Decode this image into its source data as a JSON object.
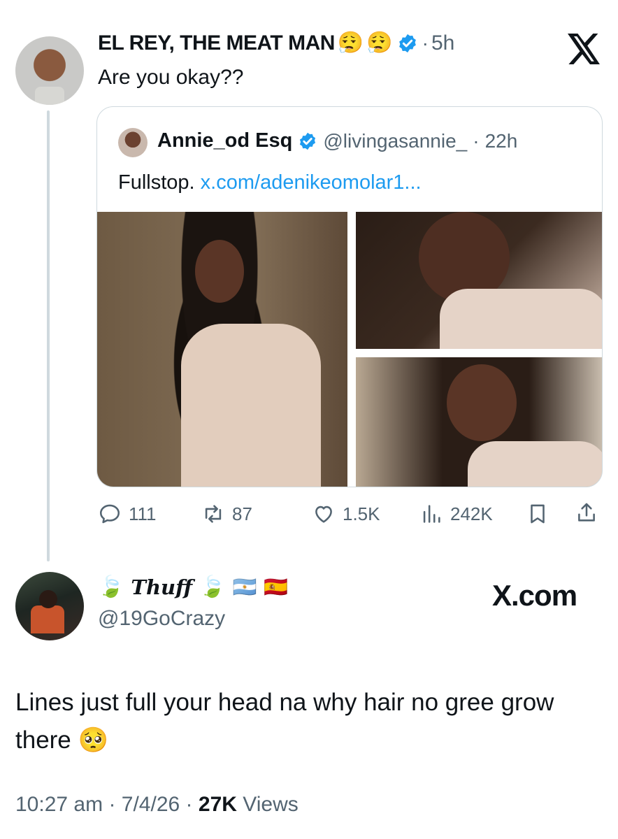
{
  "reply_tweet": {
    "author_name": "EL REY, THE MEAT MAN",
    "author_emojis": [
      "😮‍💨",
      "😮‍💨"
    ],
    "time": "5h",
    "sep": "·",
    "text": "Are you okay??",
    "x_logo": "𝕏"
  },
  "quoted_tweet": {
    "author_name": "Annie_od Esq",
    "handle": "@livingasannie_",
    "time": "22h",
    "sep": "·",
    "text": "Fullstop.",
    "link": "x.com/adenikeomolar1..."
  },
  "actions": {
    "replies": "111",
    "retweets": "87",
    "likes": "1.5K",
    "views": "242K"
  },
  "main_tweet": {
    "display_name": "Thuff",
    "leaf_emoji": "🍃",
    "flags": [
      "🇦🇷",
      "🇪🇸"
    ],
    "handle": "@19GoCrazy",
    "brand": "X.com",
    "text": "Lines just full your head na why hair no gree grow there 🥺",
    "time": "10:27 am",
    "date": "7/4/26",
    "views_count": "27K",
    "views_label": "Views",
    "sep": "·"
  },
  "colors": {
    "verified": "#1d9bf0",
    "link": "#1d9bf0",
    "muted": "#536471",
    "thread_line": "#cfd9de"
  }
}
